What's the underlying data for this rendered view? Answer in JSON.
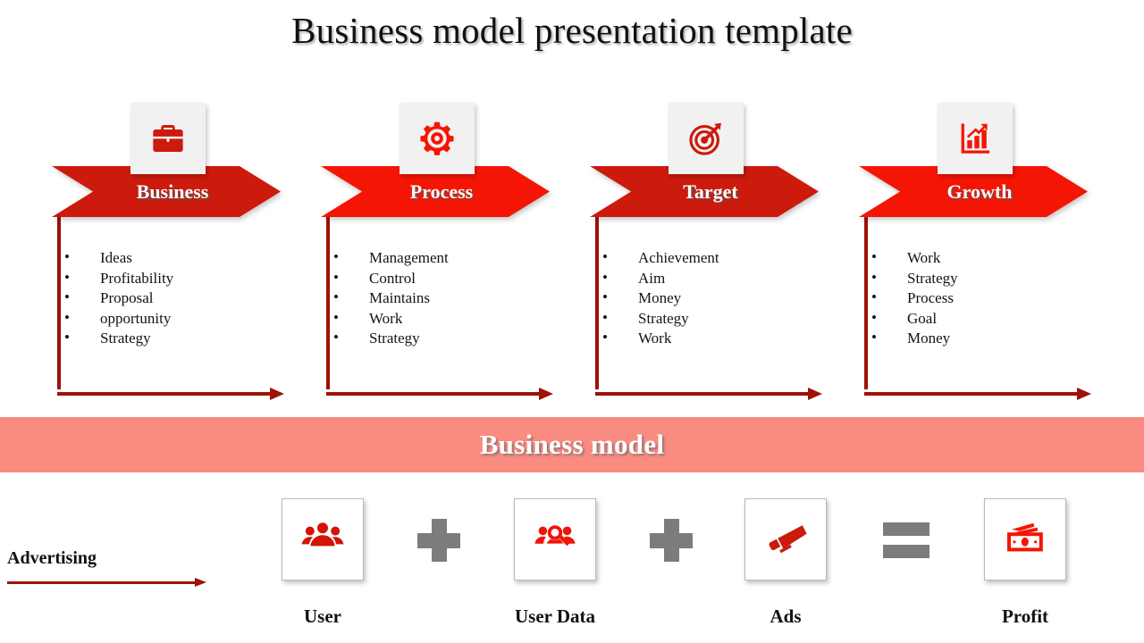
{
  "title": "Business model presentation template",
  "colors": {
    "red_dark": "#cc1a0d",
    "red_bright": "#f51505",
    "bracket": "#9e1208",
    "banner": "#f98b80",
    "icon_card_bg": "#f1f1f1",
    "operator_gray": "#7c7c7c"
  },
  "steps": [
    {
      "label": "Business",
      "icon": "briefcase-icon",
      "bullets": [
        "Ideas",
        "Profitability",
        "Proposal",
        "opportunity",
        "Strategy"
      ]
    },
    {
      "label": "Process",
      "icon": "gear-icon",
      "bullets": [
        "Management",
        "Control",
        "Maintains",
        "Work",
        "Strategy"
      ]
    },
    {
      "label": "Target",
      "icon": "target-arrow-icon",
      "bullets": [
        "Achievement",
        "Aim",
        "Money",
        "Strategy",
        "Work"
      ]
    },
    {
      "label": "Growth",
      "icon": "bar-chart-growth-icon",
      "bullets": [
        "Work",
        "Strategy",
        "Process",
        "Goal",
        "Money"
      ]
    }
  ],
  "banner": {
    "text": "Business model"
  },
  "equation": {
    "advertising_label": "Advertising",
    "items": [
      {
        "label": "User",
        "icon": "users-group-icon"
      },
      {
        "label": "User Data",
        "icon": "user-search-icon"
      },
      {
        "label": "Ads",
        "icon": "megaphone-icon"
      },
      {
        "label": "Profit",
        "icon": "banknote-icon"
      }
    ],
    "operators": [
      "plus",
      "plus",
      "equals"
    ]
  }
}
